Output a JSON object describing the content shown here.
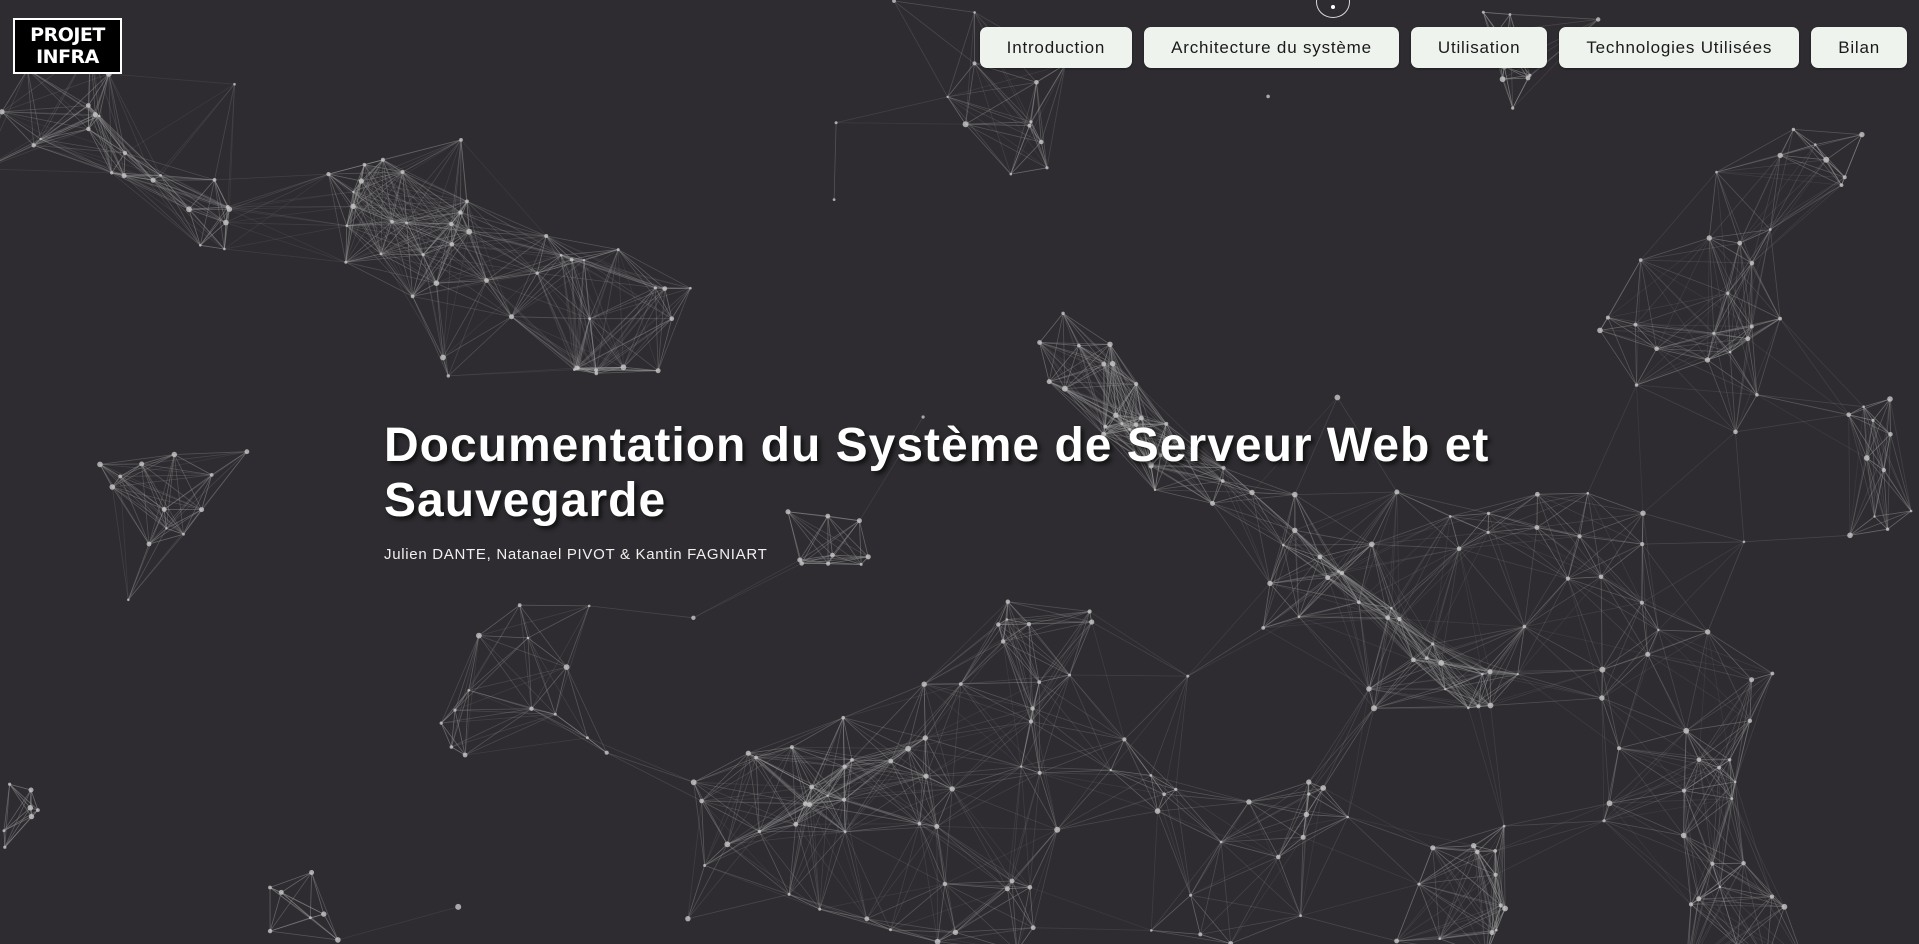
{
  "logo": {
    "line1": "PROJET",
    "line2": "INFRA"
  },
  "nav": {
    "items": [
      {
        "label": "Introduction"
      },
      {
        "label": "Architecture du système"
      },
      {
        "label": "Utilisation"
      },
      {
        "label": "Technologies Utilisées"
      },
      {
        "label": "Bilan"
      }
    ]
  },
  "hero": {
    "title": "Documentation du Système de Serveur Web et Sauvegarde",
    "authors": "Julien DANTE, Natanael PIVOT & Kantin FAGNIART"
  },
  "colors": {
    "background": "#2e2c30",
    "nav_button": "#eef3ee",
    "network_line": "#9a9a9a",
    "network_node": "#c8c8c8"
  },
  "icons": {
    "scroll_indicator": "scroll-circle-icon"
  }
}
